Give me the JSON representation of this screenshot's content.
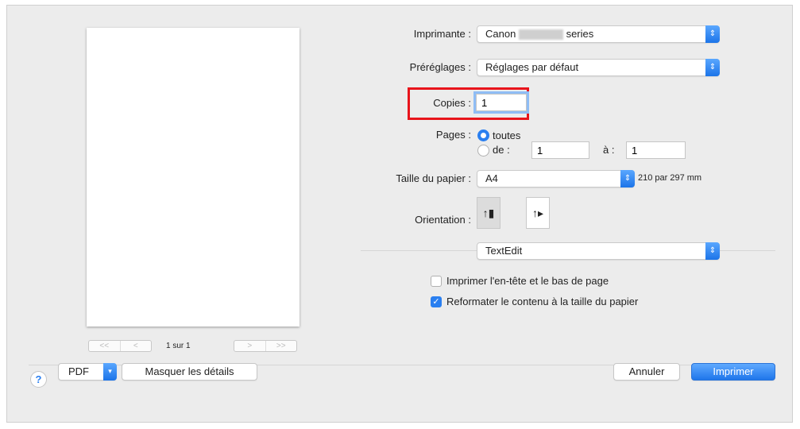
{
  "preview": {
    "page_indicator": "1 sur 1",
    "first": "<<",
    "prev": "<",
    "next": ">",
    "last": ">>"
  },
  "settings": {
    "printer": {
      "label": "Imprimante :",
      "value_prefix": "Canon",
      "value_suffix": "series"
    },
    "presets": {
      "label": "Préréglages :",
      "value": "Réglages par défaut"
    },
    "copies": {
      "label": "Copies :",
      "value": "1"
    },
    "pages": {
      "label": "Pages :",
      "all": "toutes",
      "range": "de :",
      "from": "1",
      "to_label": "à :",
      "to": "1"
    },
    "paper_size": {
      "label": "Taille du papier :",
      "value": "A4",
      "dimensions": "210 par 297 mm"
    },
    "orientation": {
      "label": "Orientation :"
    },
    "app_section": {
      "value": "TextEdit"
    },
    "checkboxes": [
      {
        "label": "Imprimer l'en-tête et le bas de page",
        "checked": false
      },
      {
        "label": "Reformater le contenu à la taille du papier",
        "checked": true
      }
    ]
  },
  "footer": {
    "help": "?",
    "pdf": "PDF",
    "hide_details": "Masquer les détails",
    "cancel": "Annuler",
    "print": "Imprimer"
  },
  "colors": {
    "accent": "#2a7ff0",
    "highlight": "#e8141b"
  }
}
